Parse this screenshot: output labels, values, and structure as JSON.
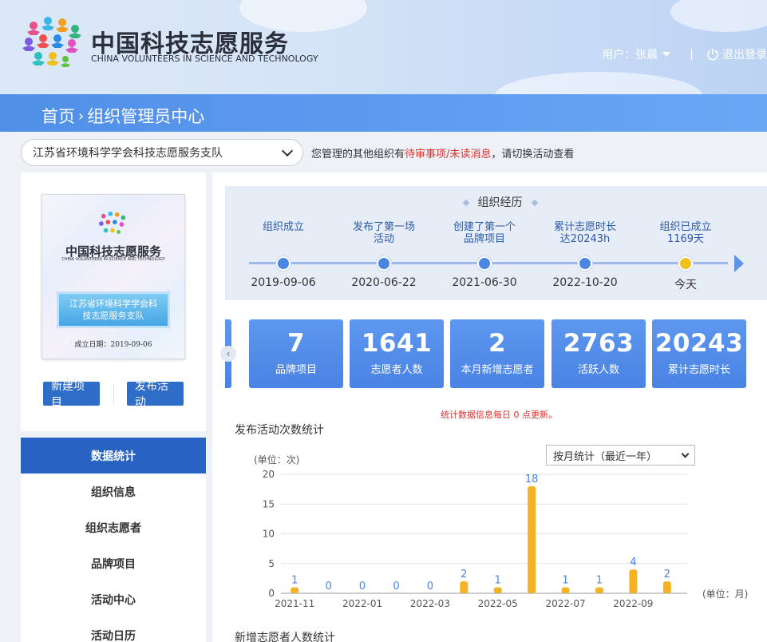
{
  "header": {
    "brand_cn": "中国科技志愿服务",
    "brand_en": "CHINA VOLUNTEERS IN SCIENCE AND TECHNOLOGY",
    "user_label": "用户：张晨",
    "logout_label": "退出登录"
  },
  "breadcrumb": {
    "home": "首页",
    "current": "组织管理员中心"
  },
  "org": {
    "selected": "江苏省环境科学学会科技志愿服务支队",
    "hint_prefix": "您管理的其他组织有",
    "hint_red": "待审事项/未读消息",
    "hint_suffix": "，请切换活动查看"
  },
  "certificate": {
    "brand_cn": "中国科技志愿服务",
    "brand_en": "CHINA VOLUNTEERS IN SCIENCE AND TECHNOLOGY",
    "org_line1": "江苏省环境科学学会科",
    "org_line2": "技志愿服务支队",
    "date": "成立日期：2019-09-06"
  },
  "actions": {
    "new_project": "新建项目",
    "publish_activity": "发布活动"
  },
  "menu": [
    {
      "label": "数据统计",
      "active": true
    },
    {
      "label": "组织信息",
      "active": false
    },
    {
      "label": "组织志愿者",
      "active": false
    },
    {
      "label": "品牌项目",
      "active": false
    },
    {
      "label": "活动中心",
      "active": false
    },
    {
      "label": "活动日历",
      "active": false
    }
  ],
  "timeline": {
    "title": "组织经历",
    "events": [
      {
        "label1": "组织成立",
        "label2": "",
        "date": "2019-09-06",
        "today": false
      },
      {
        "label1": "发布了第一场",
        "label2": "活动",
        "date": "2020-06-22",
        "today": false
      },
      {
        "label1": "创建了第一个",
        "label2": "品牌项目",
        "date": "2021-06-30",
        "today": false
      },
      {
        "label1": "累计志愿时长",
        "label2": "达20243h",
        "date": "2022-10-20",
        "today": false
      },
      {
        "label1": "组织已成立",
        "label2": "1169天",
        "date": "今天",
        "today": true
      }
    ]
  },
  "stats": [
    {
      "value": "7",
      "label": "品牌项目"
    },
    {
      "value": "1641",
      "label": "志愿者人数"
    },
    {
      "value": "2",
      "label": "本月新增志愿者"
    },
    {
      "value": "2763",
      "label": "活跃人数"
    },
    {
      "value": "20243",
      "label": "累计志愿时长"
    }
  ],
  "stats_note": "统计数据信息每日 0 点更新。",
  "activity_chart": {
    "section_title": "发布活动次数统计",
    "range_option": "按月统计（最近一年）"
  },
  "section2_title": "新增志愿者人数统计",
  "colors": {
    "primary": "#2663c2",
    "stat_card": "#4a83e3",
    "bar": "#f5b321",
    "warning_text": "#e03030"
  },
  "chart_data": {
    "type": "bar",
    "ylabel": "(单位：次)",
    "xlabel": "(单位：月)",
    "ylim": [
      0,
      20
    ],
    "yticks": [
      0,
      5,
      10,
      15,
      20
    ],
    "categories": [
      "2021-11",
      "2021-12",
      "2022-01",
      "2022-02",
      "2022-03",
      "2022-04",
      "2022-05",
      "2022-06",
      "2022-07",
      "2022-08",
      "2022-09",
      "2022-10"
    ],
    "xtick_labels": [
      "2021-11",
      "2022-01",
      "2022-03",
      "2022-05",
      "2022-07",
      "2022-09"
    ],
    "values": [
      1,
      0,
      0,
      0,
      0,
      2,
      1,
      18,
      1,
      1,
      4,
      2
    ],
    "grid": true
  }
}
